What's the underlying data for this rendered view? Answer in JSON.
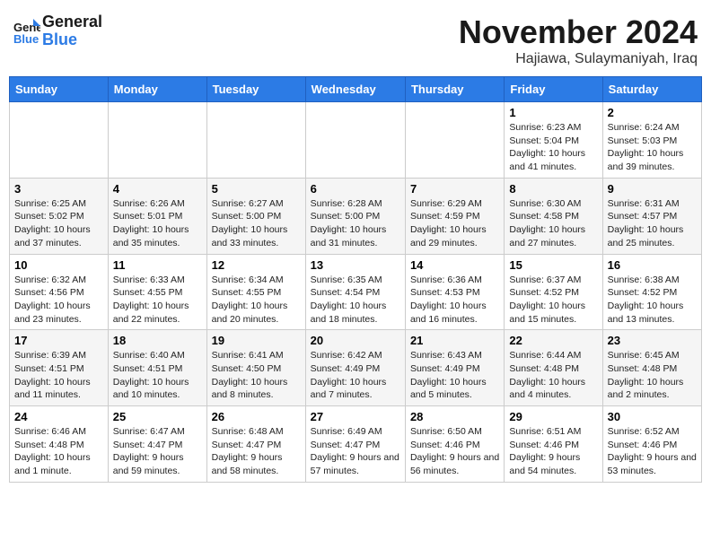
{
  "header": {
    "logo_line1": "General",
    "logo_line2": "Blue",
    "month": "November 2024",
    "location": "Hajiawa, Sulaymaniyah, Iraq"
  },
  "days_of_week": [
    "Sunday",
    "Monday",
    "Tuesday",
    "Wednesday",
    "Thursday",
    "Friday",
    "Saturday"
  ],
  "weeks": [
    [
      {
        "day": "",
        "info": ""
      },
      {
        "day": "",
        "info": ""
      },
      {
        "day": "",
        "info": ""
      },
      {
        "day": "",
        "info": ""
      },
      {
        "day": "",
        "info": ""
      },
      {
        "day": "1",
        "info": "Sunrise: 6:23 AM\nSunset: 5:04 PM\nDaylight: 10 hours and 41 minutes."
      },
      {
        "day": "2",
        "info": "Sunrise: 6:24 AM\nSunset: 5:03 PM\nDaylight: 10 hours and 39 minutes."
      }
    ],
    [
      {
        "day": "3",
        "info": "Sunrise: 6:25 AM\nSunset: 5:02 PM\nDaylight: 10 hours and 37 minutes."
      },
      {
        "day": "4",
        "info": "Sunrise: 6:26 AM\nSunset: 5:01 PM\nDaylight: 10 hours and 35 minutes."
      },
      {
        "day": "5",
        "info": "Sunrise: 6:27 AM\nSunset: 5:00 PM\nDaylight: 10 hours and 33 minutes."
      },
      {
        "day": "6",
        "info": "Sunrise: 6:28 AM\nSunset: 5:00 PM\nDaylight: 10 hours and 31 minutes."
      },
      {
        "day": "7",
        "info": "Sunrise: 6:29 AM\nSunset: 4:59 PM\nDaylight: 10 hours and 29 minutes."
      },
      {
        "day": "8",
        "info": "Sunrise: 6:30 AM\nSunset: 4:58 PM\nDaylight: 10 hours and 27 minutes."
      },
      {
        "day": "9",
        "info": "Sunrise: 6:31 AM\nSunset: 4:57 PM\nDaylight: 10 hours and 25 minutes."
      }
    ],
    [
      {
        "day": "10",
        "info": "Sunrise: 6:32 AM\nSunset: 4:56 PM\nDaylight: 10 hours and 23 minutes."
      },
      {
        "day": "11",
        "info": "Sunrise: 6:33 AM\nSunset: 4:55 PM\nDaylight: 10 hours and 22 minutes."
      },
      {
        "day": "12",
        "info": "Sunrise: 6:34 AM\nSunset: 4:55 PM\nDaylight: 10 hours and 20 minutes."
      },
      {
        "day": "13",
        "info": "Sunrise: 6:35 AM\nSunset: 4:54 PM\nDaylight: 10 hours and 18 minutes."
      },
      {
        "day": "14",
        "info": "Sunrise: 6:36 AM\nSunset: 4:53 PM\nDaylight: 10 hours and 16 minutes."
      },
      {
        "day": "15",
        "info": "Sunrise: 6:37 AM\nSunset: 4:52 PM\nDaylight: 10 hours and 15 minutes."
      },
      {
        "day": "16",
        "info": "Sunrise: 6:38 AM\nSunset: 4:52 PM\nDaylight: 10 hours and 13 minutes."
      }
    ],
    [
      {
        "day": "17",
        "info": "Sunrise: 6:39 AM\nSunset: 4:51 PM\nDaylight: 10 hours and 11 minutes."
      },
      {
        "day": "18",
        "info": "Sunrise: 6:40 AM\nSunset: 4:51 PM\nDaylight: 10 hours and 10 minutes."
      },
      {
        "day": "19",
        "info": "Sunrise: 6:41 AM\nSunset: 4:50 PM\nDaylight: 10 hours and 8 minutes."
      },
      {
        "day": "20",
        "info": "Sunrise: 6:42 AM\nSunset: 4:49 PM\nDaylight: 10 hours and 7 minutes."
      },
      {
        "day": "21",
        "info": "Sunrise: 6:43 AM\nSunset: 4:49 PM\nDaylight: 10 hours and 5 minutes."
      },
      {
        "day": "22",
        "info": "Sunrise: 6:44 AM\nSunset: 4:48 PM\nDaylight: 10 hours and 4 minutes."
      },
      {
        "day": "23",
        "info": "Sunrise: 6:45 AM\nSunset: 4:48 PM\nDaylight: 10 hours and 2 minutes."
      }
    ],
    [
      {
        "day": "24",
        "info": "Sunrise: 6:46 AM\nSunset: 4:48 PM\nDaylight: 10 hours and 1 minute."
      },
      {
        "day": "25",
        "info": "Sunrise: 6:47 AM\nSunset: 4:47 PM\nDaylight: 9 hours and 59 minutes."
      },
      {
        "day": "26",
        "info": "Sunrise: 6:48 AM\nSunset: 4:47 PM\nDaylight: 9 hours and 58 minutes."
      },
      {
        "day": "27",
        "info": "Sunrise: 6:49 AM\nSunset: 4:47 PM\nDaylight: 9 hours and 57 minutes."
      },
      {
        "day": "28",
        "info": "Sunrise: 6:50 AM\nSunset: 4:46 PM\nDaylight: 9 hours and 56 minutes."
      },
      {
        "day": "29",
        "info": "Sunrise: 6:51 AM\nSunset: 4:46 PM\nDaylight: 9 hours and 54 minutes."
      },
      {
        "day": "30",
        "info": "Sunrise: 6:52 AM\nSunset: 4:46 PM\nDaylight: 9 hours and 53 minutes."
      }
    ]
  ]
}
